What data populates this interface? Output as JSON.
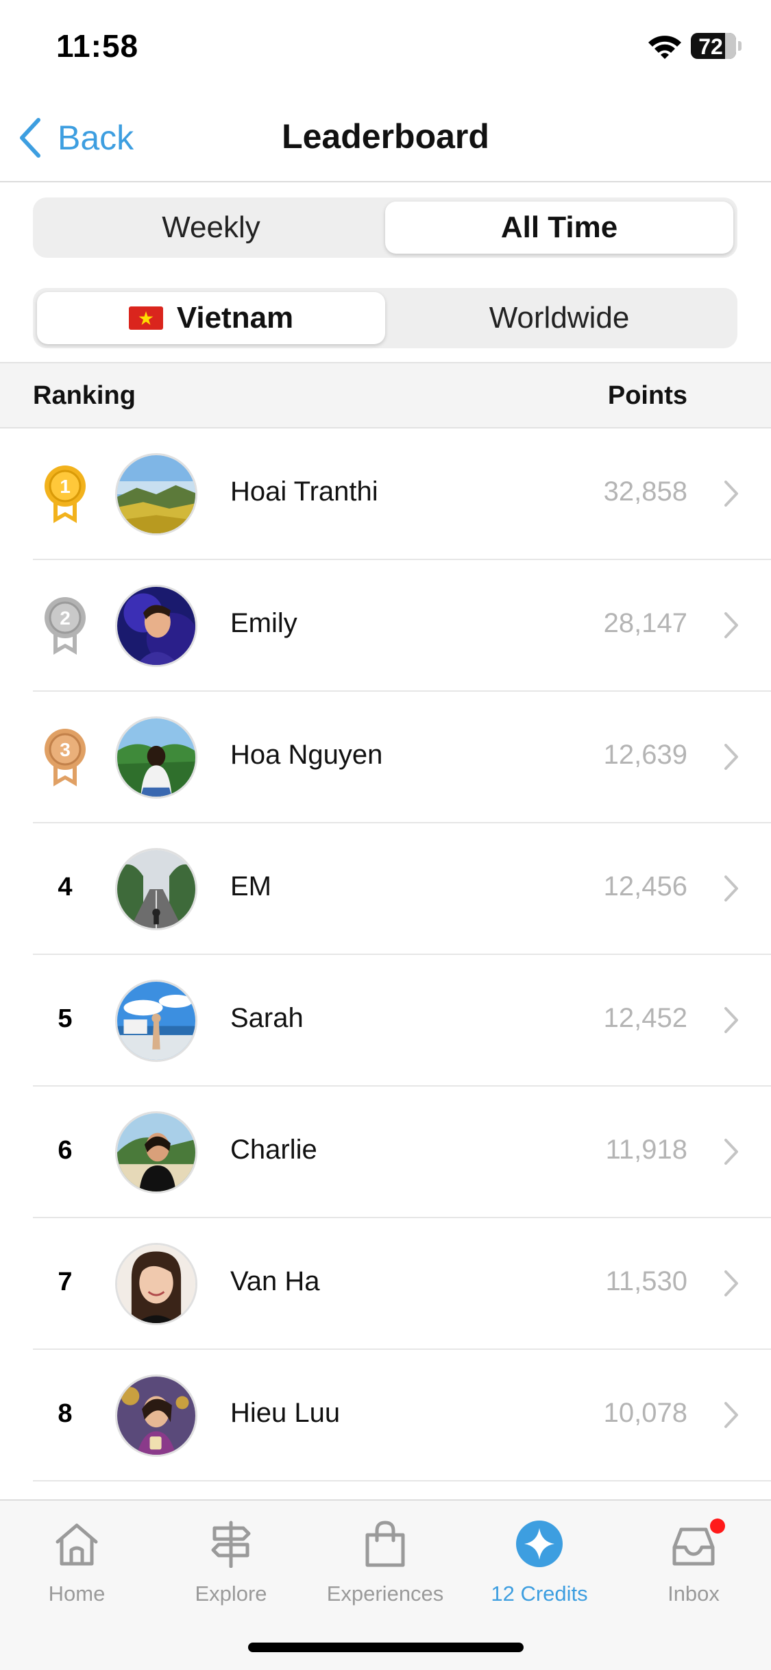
{
  "status_bar": {
    "time": "11:58",
    "battery": "72"
  },
  "nav": {
    "back_label": "Back",
    "title": "Leaderboard"
  },
  "period_tabs": [
    {
      "label": "Weekly",
      "active": false
    },
    {
      "label": "All Time",
      "active": true
    }
  ],
  "region_tabs": [
    {
      "label": "Vietnam",
      "active": true,
      "icon": "vietnam-flag-icon"
    },
    {
      "label": "Worldwide",
      "active": false
    }
  ],
  "table_header": {
    "ranking": "Ranking",
    "points": "Points"
  },
  "leaders": [
    {
      "rank": "1",
      "medal": "gold",
      "name": "Hoai Tranthi",
      "points": "32,858"
    },
    {
      "rank": "2",
      "medal": "silver",
      "name": "Emily",
      "points": "28,147"
    },
    {
      "rank": "3",
      "medal": "bronze",
      "name": "Hoa Nguyen",
      "points": "12,639"
    },
    {
      "rank": "4",
      "name": "EM",
      "points": "12,456"
    },
    {
      "rank": "5",
      "name": "Sarah",
      "points": "12,452"
    },
    {
      "rank": "6",
      "name": "Charlie",
      "points": "11,918"
    },
    {
      "rank": "7",
      "name": "Van Ha",
      "points": "11,530"
    },
    {
      "rank": "8",
      "name": "Hieu Luu",
      "points": "10,078"
    }
  ],
  "tab_bar": [
    {
      "label": "Home",
      "icon": "home-icon",
      "active": false
    },
    {
      "label": "Explore",
      "icon": "signpost-icon",
      "active": false
    },
    {
      "label": "Experiences",
      "icon": "shopping-bag-icon",
      "active": false
    },
    {
      "label": "12 Credits",
      "icon": "credits-star-icon",
      "active": true
    },
    {
      "label": "Inbox",
      "icon": "inbox-icon",
      "active": false,
      "badge": true
    }
  ],
  "colors": {
    "accent": "#3d9ee0",
    "gold": "#f2b21c",
    "silver": "#b3b3b3",
    "bronze": "#e0a064",
    "badge": "#ff1a1a"
  }
}
